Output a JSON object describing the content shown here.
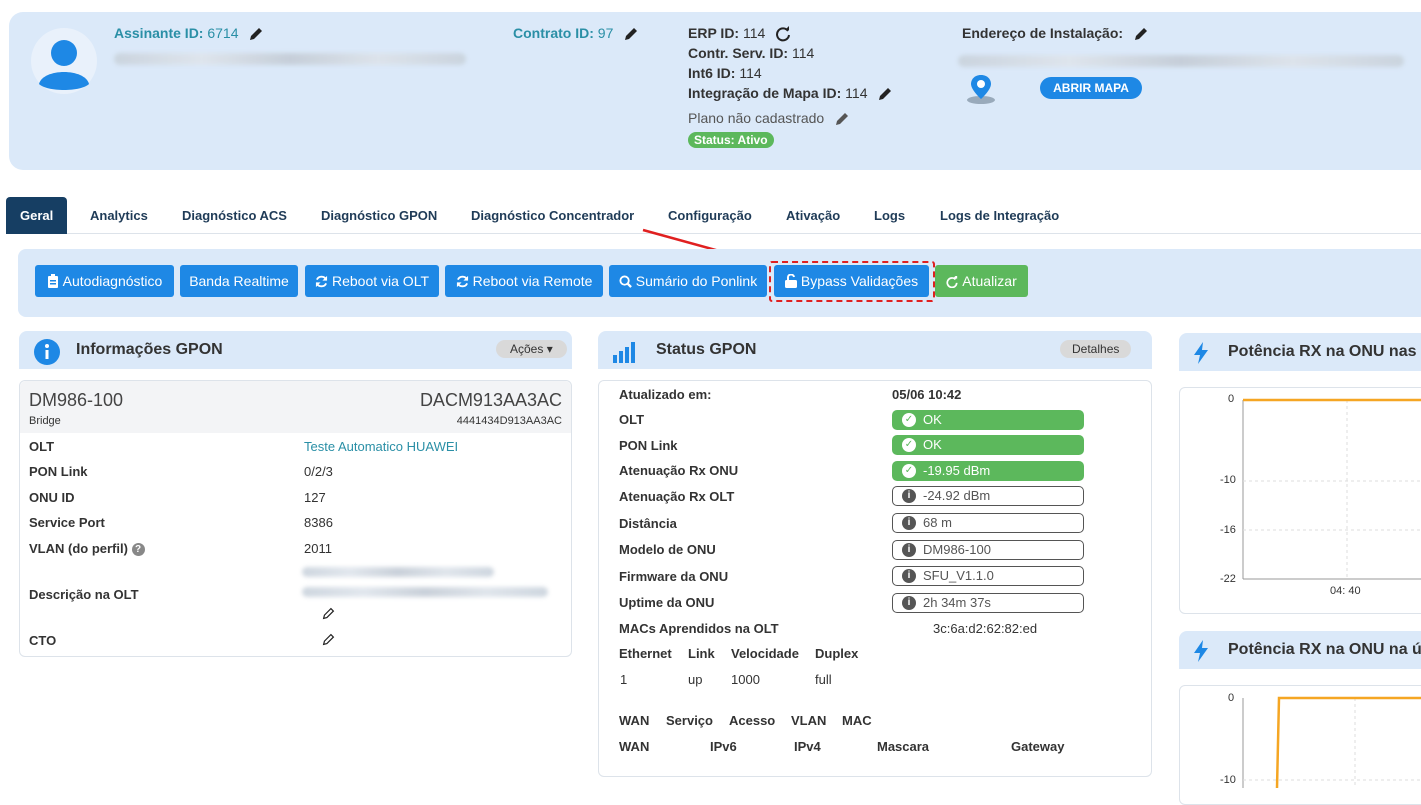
{
  "subscriber": {
    "id_label": "Assinante ID:",
    "id_value": "6714",
    "contract_label": "Contrato ID:",
    "contract_value": "97",
    "erp_label": "ERP ID:",
    "erp_value": "114",
    "contr_serv_label": "Contr. Serv. ID:",
    "contr_serv_value": "114",
    "int6_label": "Int6 ID:",
    "int6_value": "114",
    "map_integration_label": "Integração de Mapa ID:",
    "map_integration_value": "114",
    "plan_text": "Plano não cadastrado",
    "status_badge": "Status: Ativo",
    "address_label": "Endereço de Instalação:",
    "map_button": "ABRIR MAPA"
  },
  "tabs": [
    {
      "label": "Geral"
    },
    {
      "label": "Analytics"
    },
    {
      "label": "Diagnóstico ACS"
    },
    {
      "label": "Diagnóstico GPON"
    },
    {
      "label": "Diagnóstico Concentrador"
    },
    {
      "label": "Configuração"
    },
    {
      "label": "Ativação"
    },
    {
      "label": "Logs"
    },
    {
      "label": "Logs de Integração"
    }
  ],
  "toolbar": {
    "autodiag": "Autodiagnóstico",
    "banda": "Banda Realtime",
    "reboot_olt": "Reboot via OLT",
    "reboot_remote": "Reboot via Remote",
    "sumario": "Sumário do Ponlink",
    "bypass": "Bypass Validações",
    "atualizar": "Atualizar"
  },
  "gpon_info": {
    "title": "Informações GPON",
    "actions": "Ações",
    "model": "DM986-100",
    "serial": "DACM913AA3AC",
    "mode": "Bridge",
    "serial_hex": "4441434D913AA3AC",
    "rows": [
      {
        "label": "OLT",
        "value": "Teste Automatico HUAWEI"
      },
      {
        "label": "PON Link",
        "value": "0/2/3"
      },
      {
        "label": "ONU ID",
        "value": "127"
      },
      {
        "label": "Service Port",
        "value": "8386"
      },
      {
        "label": "VLAN (do perfil)",
        "value": "2011"
      },
      {
        "label": "Descrição na OLT",
        "value": ""
      },
      {
        "label": "CTO",
        "value": ""
      }
    ]
  },
  "gpon_status": {
    "title": "Status GPON",
    "details": "Detalhes",
    "updated_label": "Atualizado em:",
    "updated_value": "05/06 10:42",
    "rows": [
      {
        "label": "OLT",
        "value": "OK",
        "kind": "ok"
      },
      {
        "label": "PON Link",
        "value": "OK",
        "kind": "ok"
      },
      {
        "label": "Atenuação Rx ONU",
        "value": "-19.95 dBm",
        "kind": "ok"
      },
      {
        "label": "Atenuação Rx OLT",
        "value": "-24.92 dBm",
        "kind": "info"
      },
      {
        "label": "Distância",
        "value": "68 m",
        "kind": "info"
      },
      {
        "label": "Modelo de ONU",
        "value": "DM986-100",
        "kind": "info"
      },
      {
        "label": "Firmware da ONU",
        "value": "SFU_V1.1.0",
        "kind": "info"
      },
      {
        "label": "Uptime da ONU",
        "value": "2h 34m 37s",
        "kind": "info"
      }
    ],
    "macs_label": "MACs Aprendidos na OLT",
    "macs_value": "3c:6a:d2:62:82:ed",
    "eth_headers": [
      "Ethernet",
      "Link",
      "Velocidade",
      "Duplex"
    ],
    "eth_row": [
      "1",
      "up",
      "1000",
      "full"
    ],
    "wan_headers": [
      "WAN",
      "Serviço",
      "Acesso",
      "VLAN",
      "MAC"
    ],
    "wan2_headers": [
      "WAN",
      "IPv6",
      "IPv4",
      "Mascara",
      "Gateway"
    ]
  },
  "chart1": {
    "title": "Potência RX na ONU nas",
    "chart_data": {
      "type": "line",
      "x": [
        "04: 40"
      ],
      "y_ticks": [
        0,
        -10,
        -16,
        -22
      ],
      "series": [
        {
          "values": [
            0,
            0
          ]
        }
      ]
    }
  },
  "chart2": {
    "title": "Potência RX na ONU na ú",
    "chart_data": {
      "type": "line",
      "y_ticks": [
        0,
        -10
      ],
      "series": [
        {
          "values": [
            -10,
            0,
            0
          ]
        }
      ]
    }
  },
  "colors": {
    "primary": "#1e88e5",
    "success": "#5cb85c",
    "tab_active": "#163e63",
    "panel_bg": "#dbe9f9",
    "chart_line": "#f5a623"
  }
}
